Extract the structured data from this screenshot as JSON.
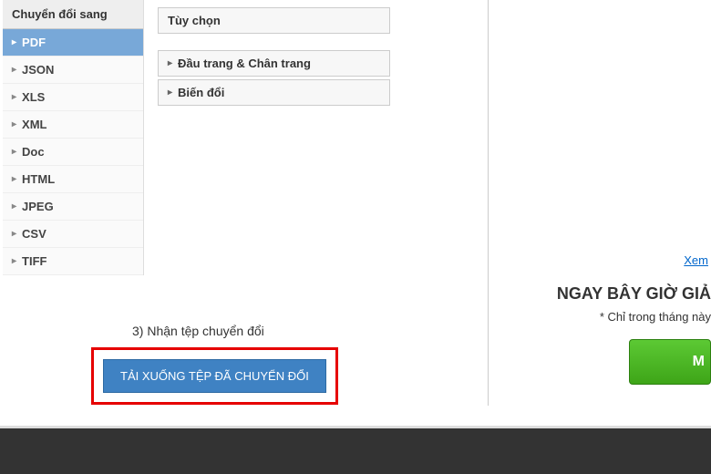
{
  "sidebar": {
    "header": "Chuyển đổi sang",
    "items": [
      {
        "label": "PDF",
        "active": true
      },
      {
        "label": "JSON"
      },
      {
        "label": "XLS"
      },
      {
        "label": "XML"
      },
      {
        "label": "Doc"
      },
      {
        "label": "HTML"
      },
      {
        "label": "JPEG"
      },
      {
        "label": "CSV"
      },
      {
        "label": "TIFF"
      }
    ]
  },
  "accordion": {
    "items": [
      {
        "label": "Tùy chọn"
      },
      {
        "label": "Đầu trang & Chân trang"
      },
      {
        "label": "Biến đổi"
      }
    ]
  },
  "step": {
    "label": "3) Nhận tệp chuyển đổi",
    "button": "TẢI XUỐNG TỆP ĐÃ CHUYỂN ĐỔI"
  },
  "right": {
    "link": "Xem",
    "title": "NGAY BÂY GIỜ GIẢ",
    "sub": "* Chỉ trong tháng này",
    "button": "M"
  }
}
